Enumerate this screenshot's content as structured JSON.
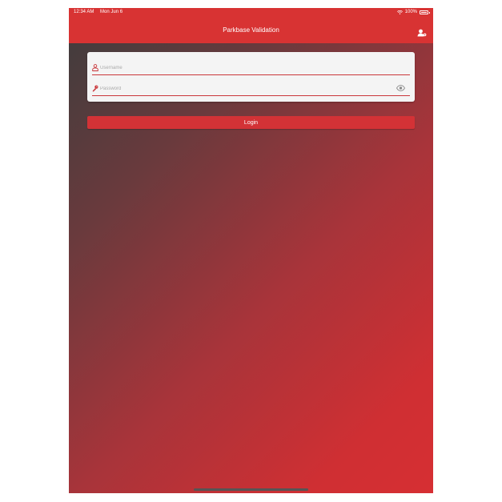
{
  "status_bar": {
    "time": "12:34 AM",
    "date": "Mon Jun 6",
    "battery": "100%",
    "icons": [
      "wifi-icon",
      "battery-icon"
    ]
  },
  "navbar": {
    "title": "Parkbase Validation",
    "user_icon": "user-settings-icon"
  },
  "login_form": {
    "username": {
      "placeholder": "Username",
      "value": "",
      "icon": "user-icon"
    },
    "password": {
      "placeholder": "Password",
      "value": "",
      "icon": "key-icon",
      "toggle_icon": "eye-icon"
    },
    "login_label": "Login"
  },
  "colors": {
    "accent": "#d83333",
    "gradient_start": "#3d3d3d",
    "gradient_end": "#d62f33"
  }
}
